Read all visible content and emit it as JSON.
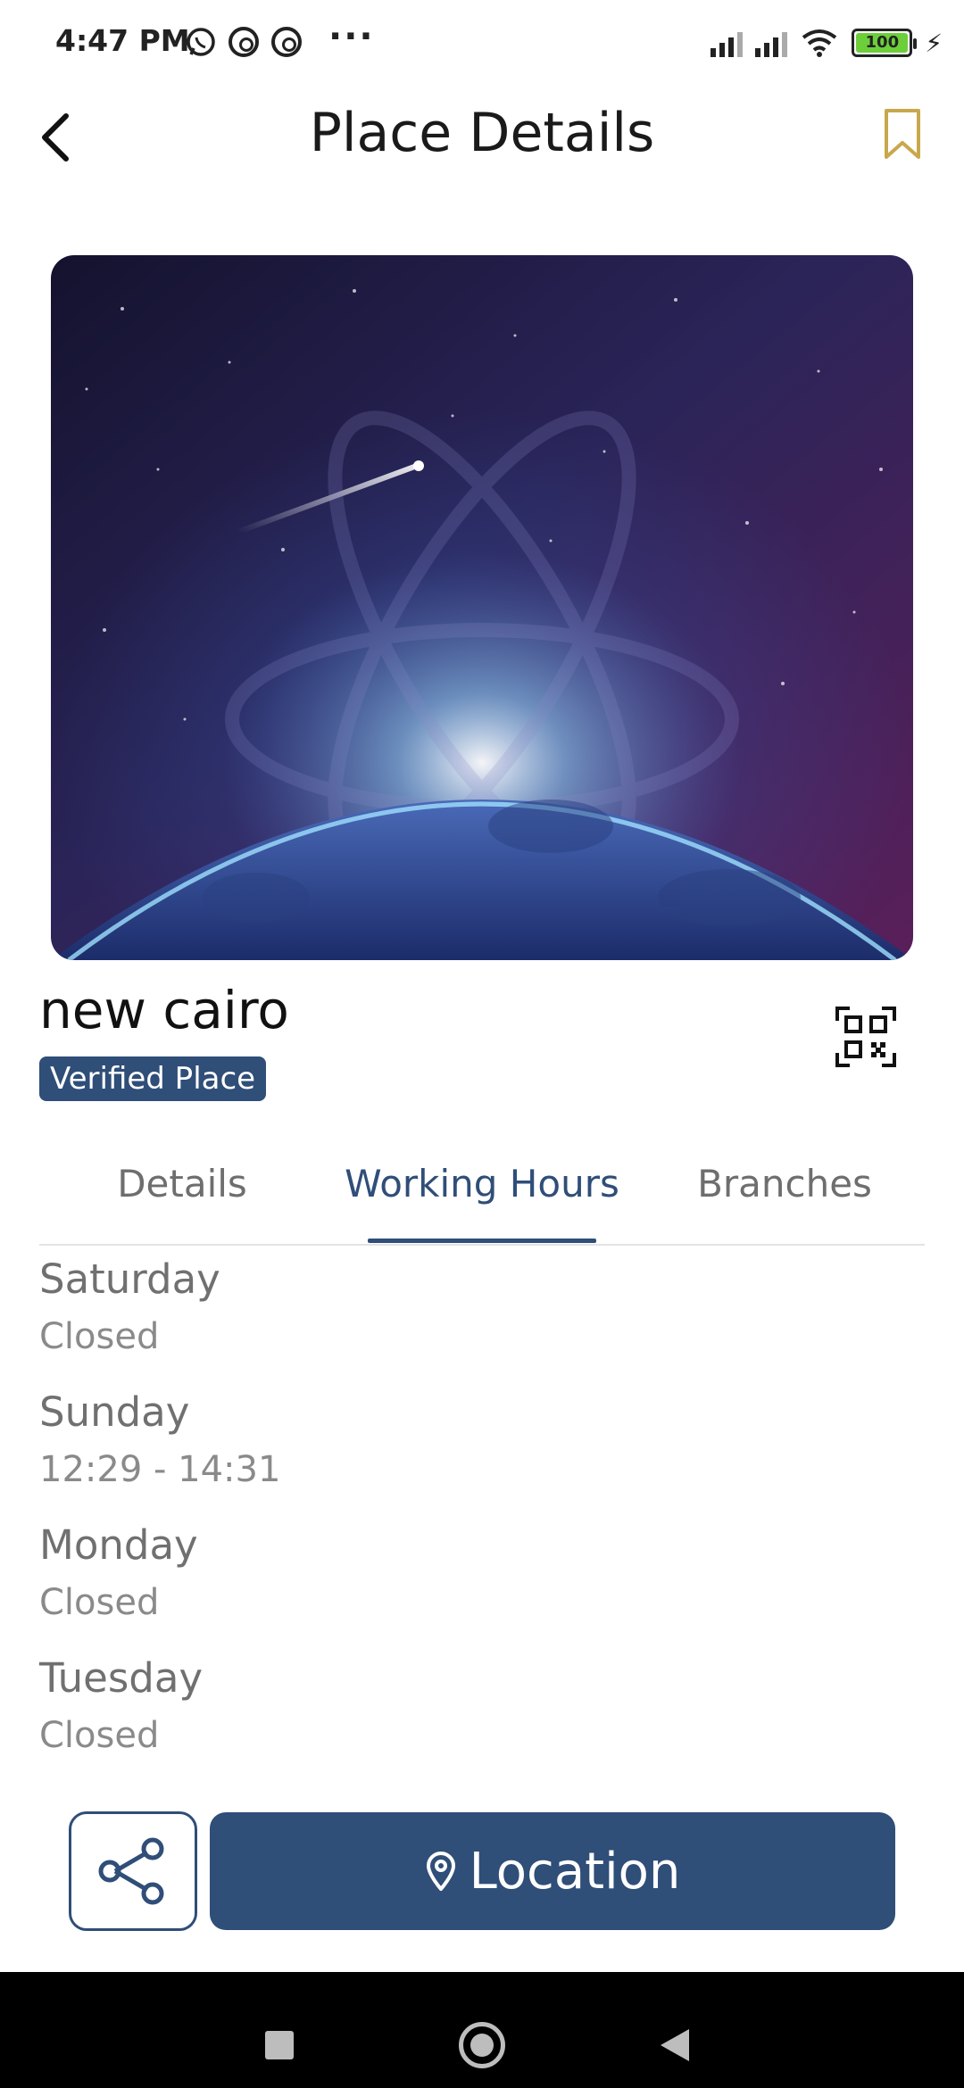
{
  "status_bar": {
    "time": "4:47 PM",
    "battery": "100",
    "icons": [
      "whatsapp-icon",
      "at-icon",
      "at-icon",
      "more-icon",
      "signal-icon",
      "signal-icon",
      "wifi-icon",
      "battery-icon",
      "charging-icon"
    ]
  },
  "header": {
    "title": "Place Details",
    "back_icon": "chevron-left-icon",
    "bookmark_icon": "bookmark-icon"
  },
  "place": {
    "name": "new cairo",
    "badge": "Verified Place",
    "qr_icon": "qr-code-icon"
  },
  "tabs": [
    {
      "label": "Details",
      "active": false
    },
    {
      "label": "Working Hours",
      "active": true
    },
    {
      "label": "Branches",
      "active": false
    }
  ],
  "working_hours": [
    {
      "day": "Saturday",
      "hours": "Closed"
    },
    {
      "day": "Sunday",
      "hours": "12:29 - 14:31"
    },
    {
      "day": "Monday",
      "hours": "Closed"
    },
    {
      "day": "Tuesday",
      "hours": "Closed"
    }
  ],
  "actions": {
    "share_icon": "share-icon",
    "location_label": "Location",
    "location_icon": "map-pin-icon"
  },
  "colors": {
    "primary": "#2f4e78",
    "bookmark": "#c9a74c",
    "badge_bg": "#2f4e78",
    "text_muted": "#707070"
  }
}
